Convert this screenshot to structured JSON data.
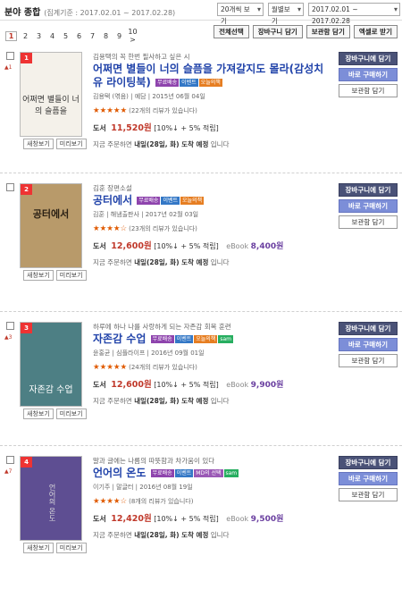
{
  "header": {
    "title": "분야 종합",
    "period": "(집계기준 : 2017.02.01 ~ 2017.02.28)",
    "view_count": "20개씩 보기",
    "period_view": "월별보기",
    "date_range": "2017.02.01 ~ 2017.02.28"
  },
  "pagination": {
    "pages": [
      "1",
      "2",
      "3",
      "4",
      "5",
      "6",
      "7",
      "8",
      "9",
      "10"
    ],
    "current": "1",
    "next": "10 >"
  },
  "toolbar": {
    "select_all": "전체선택",
    "add_cart": "장바구니 담기",
    "keep": "보관함 담기",
    "excel": "엑셀로 받기"
  },
  "actions": {
    "cart": "장바구니에 담기",
    "buy": "바로 구매하기",
    "keep": "보관함 담기"
  },
  "preview": {
    "new_view": "새창보기",
    "preview": "미리보기"
  },
  "books": [
    {
      "rank": "1",
      "rank_change": "▲1",
      "subtitle": "김용택의 꼭 한번 필사하고 싶은 시",
      "title": "어쩌면 별들이 너의 슬픔을 가져갈지도 몰라(감성치유 라이팅북)",
      "badges": [
        [
          "무료배송",
          "b-free"
        ],
        [
          "이벤트",
          "b-event"
        ],
        [
          "오늘의책",
          "b-today"
        ]
      ],
      "meta": "김용택 (엮음) | 예담 | 2015년 06월 04일",
      "stars": "★★★★★",
      "reviews": "(22개의 리뷰가 있습니다)",
      "price_label": "도서",
      "price": "11,520원",
      "discount": "[10%↓ + 5% 적립]",
      "ebook_label": "",
      "ebook_price": "",
      "ship_prefix": "지금 주문하면",
      "ship_day": "내일(28일, 화) 도착 예정",
      "ship_suffix": "입니다",
      "cover_text": "어쩌면 별들이 너의 슬픔을"
    },
    {
      "rank": "2",
      "rank_change": "",
      "subtitle": "김훈 장편소설",
      "title": "공터에서",
      "badges": [
        [
          "무료배송",
          "b-free"
        ],
        [
          "이벤트",
          "b-event"
        ],
        [
          "오늘의책",
          "b-today"
        ]
      ],
      "meta": "김훈 | 해냄출판사 | 2017년 02월 03일",
      "stars": "★★★★☆",
      "reviews": "(23개의 리뷰가 있습니다)",
      "price_label": "도서",
      "price": "12,600원",
      "discount": "[10%↓ + 5% 적립]",
      "ebook_label": "eBook",
      "ebook_price": "8,400원",
      "ship_prefix": "지금 주문하면",
      "ship_day": "내일(28일, 화) 도착 예정",
      "ship_suffix": "입니다",
      "cover_text": "공터에서"
    },
    {
      "rank": "3",
      "rank_change": "▲3",
      "subtitle": "하루에 하나 나를 사랑하게 되는 자존감 회복 훈련",
      "title": "자존감 수업",
      "badges": [
        [
          "무료배송",
          "b-free"
        ],
        [
          "이벤트",
          "b-event"
        ],
        [
          "오늘의책",
          "b-today"
        ],
        [
          "sam",
          "b-sam"
        ]
      ],
      "meta": "윤홍균 | 심플라이프 | 2016년 09월 01일",
      "stars": "★★★★★",
      "reviews": "(24개의 리뷰가 있습니다)",
      "price_label": "도서",
      "price": "12,600원",
      "discount": "[10%↓ + 5% 적립]",
      "ebook_label": "eBook",
      "ebook_price": "9,900원",
      "ship_prefix": "지금 주문하면",
      "ship_day": "내일(28일, 화) 도착 예정",
      "ship_suffix": "입니다",
      "cover_text": "자존감 수업"
    },
    {
      "rank": "4",
      "rank_change": "▲7",
      "subtitle": "말과 글에는 나름의 따뜻함과 차가움이 있다",
      "title": "언어의 온도",
      "badges": [
        [
          "무료배송",
          "b-free"
        ],
        [
          "이벤트",
          "b-event"
        ],
        [
          "MD의 선택",
          "b-md"
        ],
        [
          "sam",
          "b-sam"
        ]
      ],
      "meta": "이기주 | 말글터 | 2016년 08월 19일",
      "stars": "★★★★☆",
      "reviews": "(8개의 리뷰가 있습니다)",
      "price_label": "도서",
      "price": "12,420원",
      "discount": "[10%↓ + 5% 적립]",
      "ebook_label": "eBook",
      "ebook_price": "9,500원",
      "ship_prefix": "지금 주문하면",
      "ship_day": "내일(28일, 화) 도착 예정",
      "ship_suffix": "입니다",
      "cover_text": "언어의 온도"
    }
  ]
}
